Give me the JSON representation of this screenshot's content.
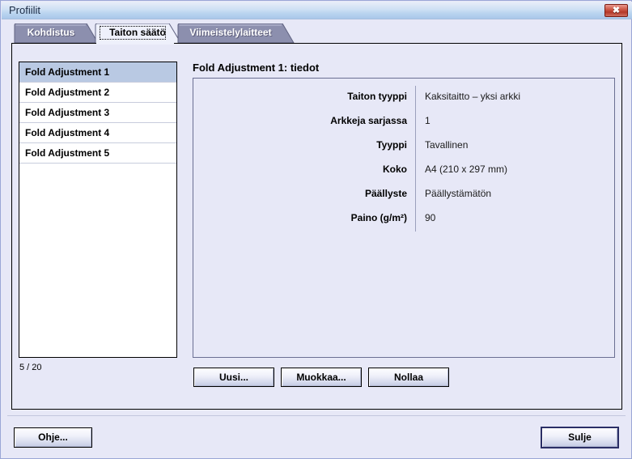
{
  "window": {
    "title": "Profiilit",
    "close_icon": "close-icon",
    "close_glyph": "✖"
  },
  "tabs": [
    {
      "id": "kohdistus",
      "label": "Kohdistus",
      "active": false
    },
    {
      "id": "taiton-saato",
      "label": "Taiton säätö",
      "active": true
    },
    {
      "id": "viimeistelylaitteet",
      "label": "Viimeistelylaitteet",
      "active": false
    }
  ],
  "list": {
    "items": [
      {
        "label": "Fold Adjustment 1",
        "selected": true
      },
      {
        "label": "Fold Adjustment 2",
        "selected": false
      },
      {
        "label": "Fold Adjustment 3",
        "selected": false
      },
      {
        "label": "Fold Adjustment 4",
        "selected": false
      },
      {
        "label": "Fold Adjustment 5",
        "selected": false
      }
    ],
    "counter": "5 / 20"
  },
  "details": {
    "title": "Fold Adjustment 1: tiedot",
    "fields": [
      {
        "label": "Taiton tyyppi",
        "value": "Kaksitaitto – yksi arkki"
      },
      {
        "label": "Arkkeja sarjassa",
        "value": "1"
      },
      {
        "label": "Tyyppi",
        "value": "Tavallinen"
      },
      {
        "label": "Koko",
        "value": "A4 (210 x 297 mm)"
      },
      {
        "label": "Päällyste",
        "value": "Päällystämätön"
      },
      {
        "label": "Paino (g/m²)",
        "value": "90"
      }
    ]
  },
  "actions": {
    "new": "Uusi...",
    "edit": "Muokkaa...",
    "reset": "Nollaa"
  },
  "footer": {
    "help": "Ohje...",
    "close": "Sulje"
  },
  "colors": {
    "dialog_bg": "#e7e8f7",
    "tab_inactive": "#8c8fae",
    "tab_active": "#eef0fb",
    "list_selected": "#b9c9e3",
    "close_button": "#b43727",
    "default_button_border": "#2b2f66"
  }
}
